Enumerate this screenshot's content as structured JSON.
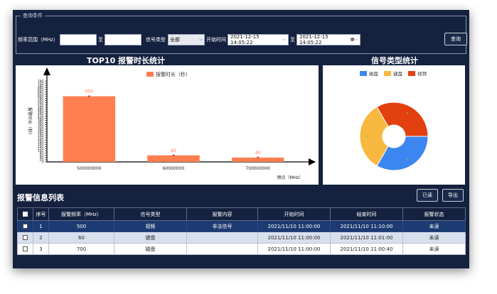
{
  "query": {
    "legend": "查询条件",
    "freq_label": "频率范围（MHz）",
    "freq_from": "",
    "to_label": "至",
    "freq_to": "",
    "signal_type_label": "信号类型",
    "signal_type_value": "全部",
    "start_label": "开始时间",
    "start_value": "2021-12-15 14:05:22",
    "end_value": "2021-12-15 14:05:22",
    "search_button": "查询"
  },
  "bar_title": "TOP10 报警时长统计",
  "pie_title": "信号类型统计",
  "chart_data": [
    {
      "type": "bar",
      "title": "TOP10 报警时长统计",
      "categories": [
        "500000000",
        "60000000",
        "700000000"
      ],
      "series": [
        {
          "name": "报警时长（秒）",
          "values": [
            600,
            60,
            40
          ]
        }
      ],
      "xlabel": "频点（MHz）",
      "ylabel": "报警时长（秒）",
      "ylim": [
        0,
        740
      ],
      "yticks": [
        0,
        20,
        40,
        60,
        80,
        100,
        120,
        140,
        160,
        180,
        200,
        220,
        240,
        260,
        280,
        300,
        320,
        340,
        360,
        380,
        400,
        420,
        440,
        460,
        480,
        500,
        520,
        540,
        560,
        580,
        600,
        620,
        640,
        660,
        680,
        700,
        720,
        740
      ],
      "color": "#ff7f50",
      "legend": "top"
    },
    {
      "type": "pie",
      "title": "信号类型统计",
      "labels": [
        "磁盘",
        "键盘",
        "视频"
      ],
      "values": [
        1,
        1,
        1
      ],
      "colors": [
        "#3b86f0",
        "#f8b840",
        "#e2400f"
      ],
      "legend": "top"
    }
  ],
  "list": {
    "title": "报警信息列表",
    "read_button": "已读",
    "export_button": "导出",
    "columns": [
      "",
      "序号",
      "报警频率（MHz）",
      "信号类型",
      "报警内容",
      "开始时间",
      "结束时间",
      "报警状态"
    ],
    "rows": [
      [
        "1",
        "500",
        "视频",
        "非法信号",
        "2021/11/10 11:00:00",
        "2021/11/10 11:10:00",
        "未读"
      ],
      [
        "2",
        "60",
        "键盘",
        "",
        "2021/11/10 11:00:00",
        "2021/11/10 11:01:00",
        "未读"
      ],
      [
        "3",
        "700",
        "磁盘",
        "",
        "2021/11/10 11:00:00",
        "2021/11/10 11:00:40",
        "未读"
      ]
    ]
  }
}
